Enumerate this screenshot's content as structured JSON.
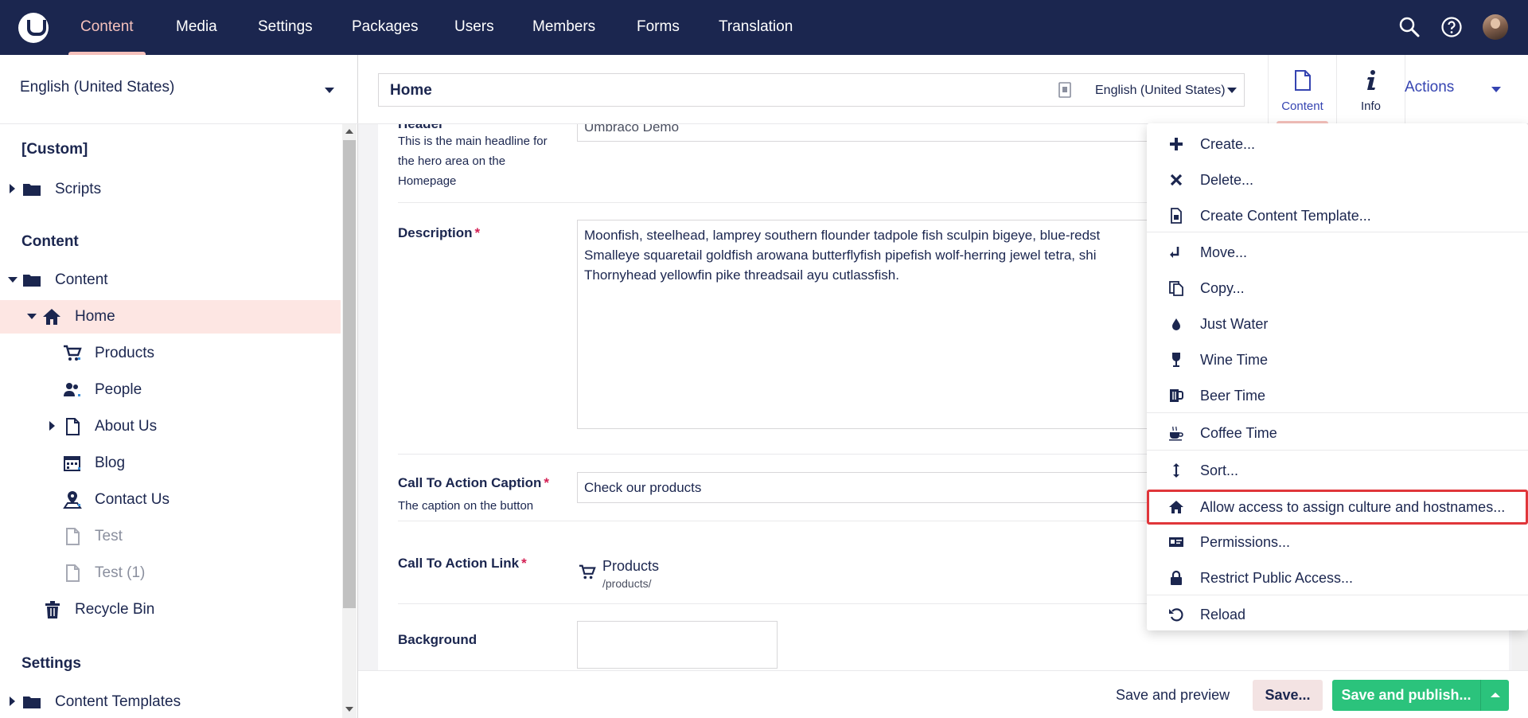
{
  "nav": {
    "items": [
      "Content",
      "Media",
      "Settings",
      "Packages",
      "Users",
      "Members",
      "Forms",
      "Translation"
    ],
    "active": "Content"
  },
  "tree": {
    "culture": "English (United States)",
    "sections": {
      "custom": "[Custom]",
      "content": "Content",
      "settings": "Settings"
    },
    "items": {
      "scripts": "Scripts",
      "content_root": "Content",
      "home": "Home",
      "products": "Products",
      "people": "People",
      "about_us": "About Us",
      "blog": "Blog",
      "contact_us": "Contact Us",
      "test": "Test",
      "test1": "Test (1)",
      "recycle_bin": "Recycle Bin",
      "content_templates": "Content Templates"
    }
  },
  "editor": {
    "node_name": "Home",
    "language": "English (United States)",
    "apps": {
      "content": "Content",
      "info": "Info"
    },
    "actions_label": "Actions",
    "properties": {
      "header": {
        "label": "Header",
        "description": "This is the main headline for the hero area on the Homepage",
        "value": "Umbraco Demo"
      },
      "description": {
        "label": "Description",
        "required": "*",
        "lines": [
          "Moonfish, steelhead, lamprey southern flounder tadpole fish sculpin bigeye, blue-redst",
          "Smalleye squaretail goldfish arowana butterflyfish pipefish wolf-herring jewel tetra, shi",
          "Thornyhead yellowfin pike threadsail ayu cutlassfish."
        ]
      },
      "cta_caption": {
        "label": "Call To Action Caption",
        "required": "*",
        "description": "The caption on the button",
        "value": "Check our products"
      },
      "cta_link": {
        "label": "Call To Action Link",
        "required": "*",
        "link_name": "Products",
        "link_url": "/products/"
      },
      "background": {
        "label": "Background"
      }
    }
  },
  "bottombar": {
    "save_preview": "Save and preview",
    "save": "Save...",
    "publish": "Save and publish..."
  },
  "actions_menu": {
    "items": [
      "Create...",
      "Delete...",
      "Create Content Template...",
      "Move...",
      "Copy...",
      "Just Water",
      "Wine Time",
      "Beer Time",
      "Coffee Time",
      "Sort...",
      "Allow access to assign culture and hostnames...",
      "Permissions...",
      "Restrict Public Access...",
      "Reload"
    ],
    "highlighted": "Allow access to assign culture and hostnames..."
  },
  "colors": {
    "topbar": "#1b264f",
    "accent_pink": "#f5c1bc",
    "selected_row": "#fde6e3",
    "publish_green": "#2bc37c",
    "link_blue": "#3544b1",
    "required_red": "#d42054",
    "highlight_red": "#e0363a"
  },
  "icons": {
    "search": "search-icon",
    "help": "help-icon",
    "folder": "folder-icon",
    "home": "home-icon",
    "cart": "cart-icon",
    "people": "people-icon",
    "document": "document-icon",
    "calendar": "calendar-icon",
    "map_pin": "map-pin-icon",
    "trash": "trash-icon"
  }
}
